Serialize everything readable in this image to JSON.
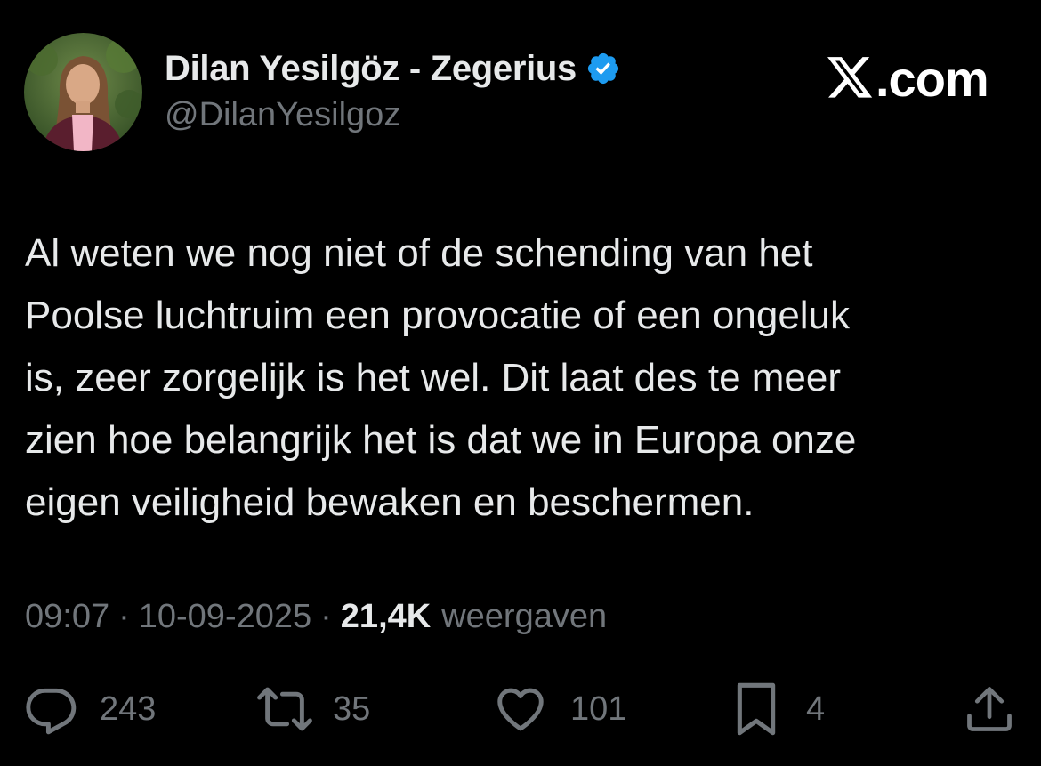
{
  "author": {
    "display_name": "Dilan Yesilgöz - Zegerius",
    "handle": "@DilanYesilgoz",
    "verified": true,
    "verified_color": "#1d9bf0"
  },
  "site": {
    "logo_text": ".com"
  },
  "tweet": {
    "text": "Al weten we nog niet of de schending van het\nPoolse luchtruim een provocatie of een ongeluk\nis, zeer zorgelijk is het wel. Dit laat des te meer\nzien hoe belangrijk het is dat we in Europa onze\neigen veiligheid bewaken en beschermen."
  },
  "meta": {
    "time": "09:07",
    "separator": "·",
    "date": "10-09-2025",
    "views_count": "21,4K",
    "views_label": "weergaven"
  },
  "actions": {
    "replies": {
      "icon": "reply-icon",
      "count": "243"
    },
    "reposts": {
      "icon": "repost-icon",
      "count": "35"
    },
    "likes": {
      "icon": "heart-icon",
      "count": "101"
    },
    "bookmarks": {
      "icon": "bookmark-icon",
      "count": "4"
    },
    "share": {
      "icon": "share-icon"
    }
  },
  "colors": {
    "background": "#000000",
    "text_primary": "#e7e9ea",
    "text_secondary": "#71767b",
    "accent": "#1d9bf0"
  }
}
